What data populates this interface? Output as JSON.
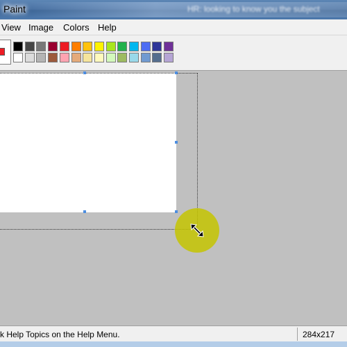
{
  "window": {
    "title": "Paint",
    "title_extra": "HR: looking to know you the subject"
  },
  "menu": {
    "items": [
      "View",
      "Image",
      "Colors",
      "Help"
    ]
  },
  "palette": {
    "foreground": "#ed1c24",
    "row1": [
      "#000000",
      "#464646",
      "#787878",
      "#990030",
      "#ed1c24",
      "#ff7e00",
      "#ffc20e",
      "#fff200",
      "#a8e61d",
      "#22b14c",
      "#00b7ef",
      "#4d6df3",
      "#2f3699",
      "#6f3198"
    ],
    "row2": [
      "#ffffff",
      "#dcdcdc",
      "#b4b4b4",
      "#9c5a3c",
      "#ffa3b1",
      "#e5aa7a",
      "#f5e49c",
      "#fff9bd",
      "#d3f9bc",
      "#9dbb61",
      "#99d9ea",
      "#709ad1",
      "#546d8e",
      "#b5a5d5"
    ]
  },
  "status": {
    "help_text": "k Help Topics on the Help Menu.",
    "size": "284x217"
  }
}
